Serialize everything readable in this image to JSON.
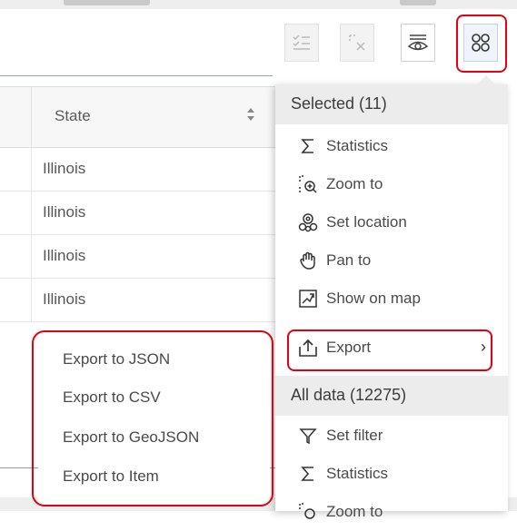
{
  "table": {
    "column_header": "State",
    "rows": [
      "Illinois",
      "Illinois",
      "Illinois",
      "Illinois"
    ]
  },
  "toolbar": {
    "buttons": [
      {
        "icon": "select-all-icon",
        "state": "disabled"
      },
      {
        "icon": "clear-selection-icon",
        "state": "disabled"
      },
      {
        "icon": "show-hide-eye-icon",
        "state": "normal"
      },
      {
        "icon": "grid-options-icon",
        "state": "active"
      }
    ]
  },
  "menu": {
    "selected_header": "Selected (11)",
    "selected_items": [
      {
        "label": "Statistics",
        "icon": "sigma-icon"
      },
      {
        "label": "Zoom to",
        "icon": "zoom-to-icon"
      },
      {
        "label": "Set location",
        "icon": "set-location-icon"
      },
      {
        "label": "Pan to",
        "icon": "pan-hand-icon"
      },
      {
        "label": "Show on map",
        "icon": "show-on-map-icon"
      },
      {
        "label": "Export",
        "icon": "export-icon",
        "chevron": "›"
      }
    ],
    "all_header": "All data (12275)",
    "all_items": [
      {
        "label": "Set filter",
        "icon": "filter-icon"
      },
      {
        "label": "Statistics",
        "icon": "sigma-icon"
      },
      {
        "label": "Zoom to",
        "icon": "zoom-to-icon"
      }
    ]
  },
  "submenu": {
    "items": [
      "Export to JSON",
      "Export to CSV",
      "Export to GeoJSON",
      "Export to Item"
    ]
  },
  "colors": {
    "highlight": "#e3000f",
    "menu_header_bg": "#ececec",
    "active_button_bg": "#eef4fa"
  }
}
